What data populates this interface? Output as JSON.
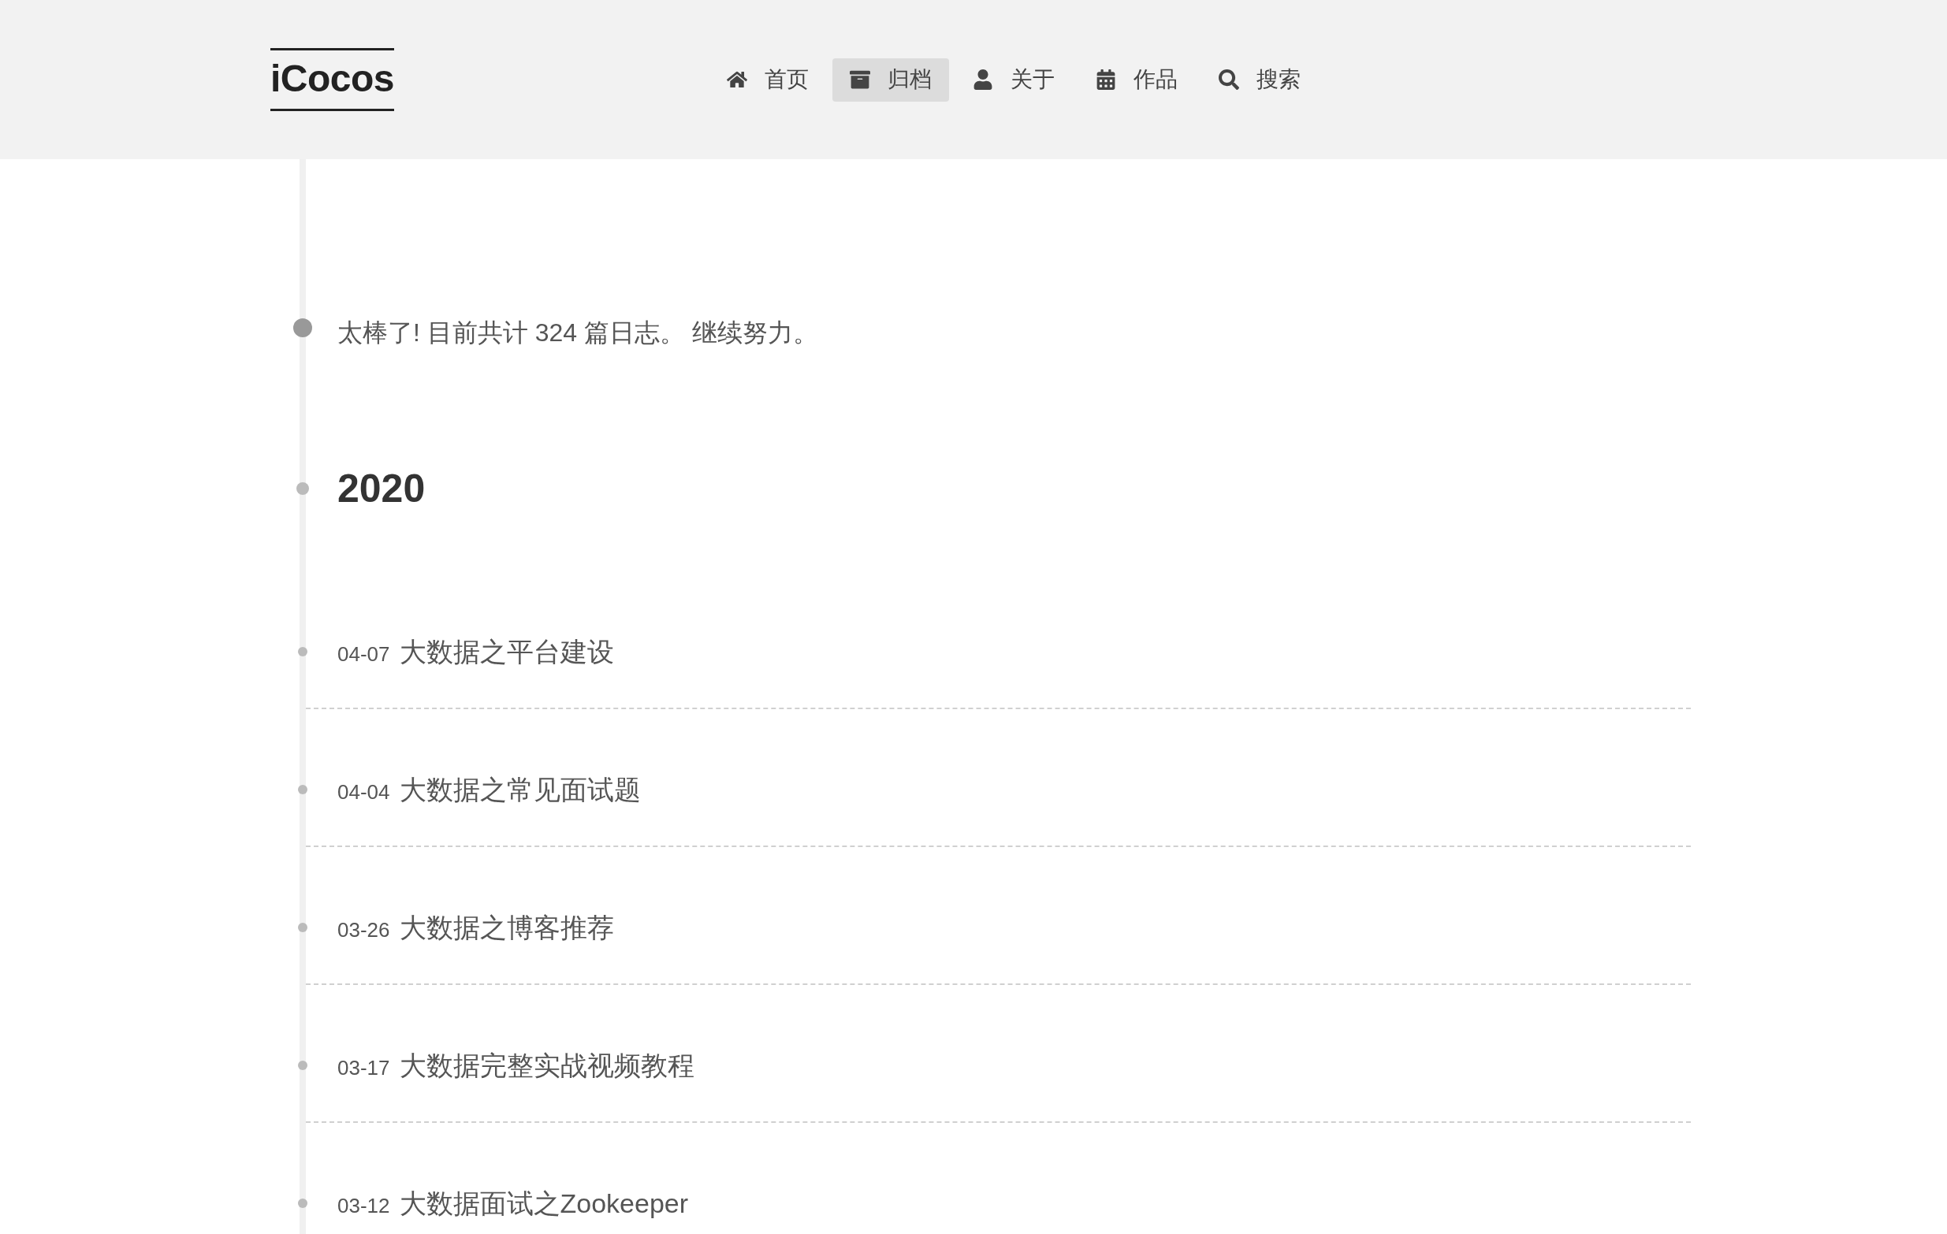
{
  "logo": "iCocos",
  "nav": [
    {
      "label": "首页",
      "kind": "home",
      "selected": false
    },
    {
      "label": "归档",
      "kind": "archive",
      "selected": true
    },
    {
      "label": "关于",
      "kind": "user",
      "selected": false
    },
    {
      "label": "作品",
      "kind": "calendar",
      "selected": false
    },
    {
      "label": "搜索",
      "kind": "search",
      "selected": false
    }
  ],
  "intro": "太棒了! 目前共计 324 篇日志。 继续努力。",
  "year": "2020",
  "posts": [
    {
      "date": "04-07",
      "title": "大数据之平台建设"
    },
    {
      "date": "04-04",
      "title": "大数据之常见面试题"
    },
    {
      "date": "03-26",
      "title": "大数据之博客推荐"
    },
    {
      "date": "03-17",
      "title": "大数据完整实战视频教程"
    },
    {
      "date": "03-12",
      "title": "大数据面试之Zookeeper"
    }
  ]
}
